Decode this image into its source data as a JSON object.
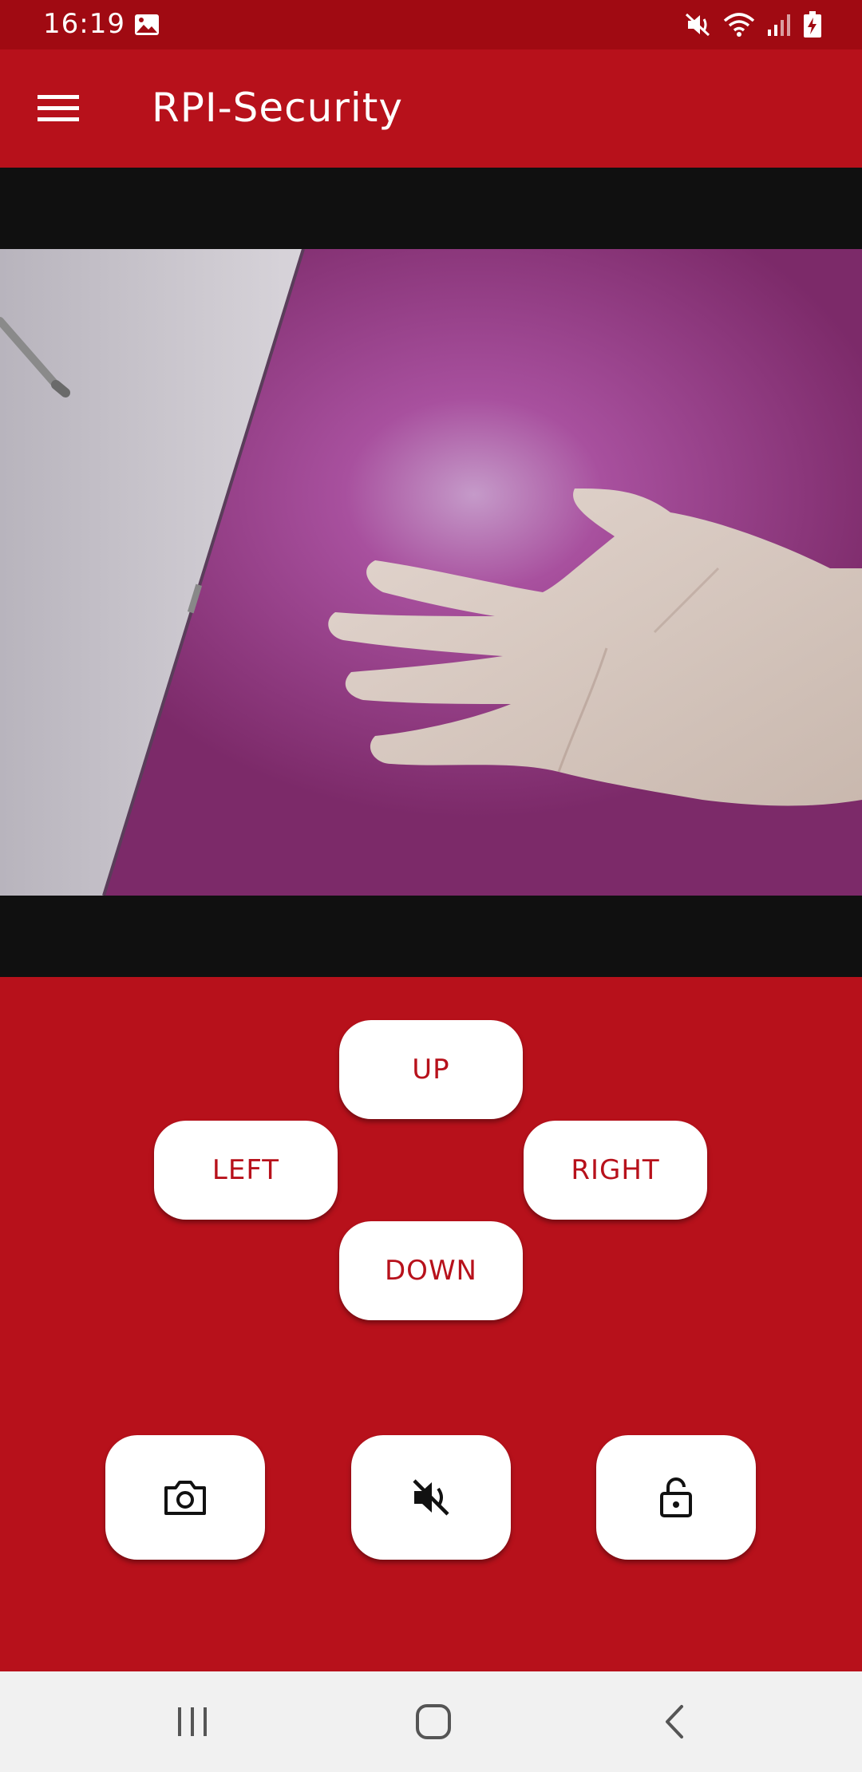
{
  "status_bar": {
    "time": "16:19",
    "icons": [
      "gallery-icon",
      "mute-icon",
      "wifi-icon",
      "signal-icon",
      "battery-charging-icon"
    ]
  },
  "app_bar": {
    "title": "RPI-Security",
    "menu_icon": "hamburger-menu-icon"
  },
  "controls": {
    "up": "UP",
    "left": "LEFT",
    "right": "RIGHT",
    "down": "DOWN"
  },
  "actions": [
    {
      "icon": "camera-icon"
    },
    {
      "icon": "volume-off-icon"
    },
    {
      "icon": "lock-open-icon"
    }
  ],
  "nav_bar": {
    "icons": [
      "recent-apps-icon",
      "home-icon",
      "back-icon"
    ]
  },
  "colors": {
    "primary": "#b7111b",
    "status_bar": "#a00a12",
    "button_bg": "#ffffff",
    "nav_bar": "#f1f1f1"
  }
}
